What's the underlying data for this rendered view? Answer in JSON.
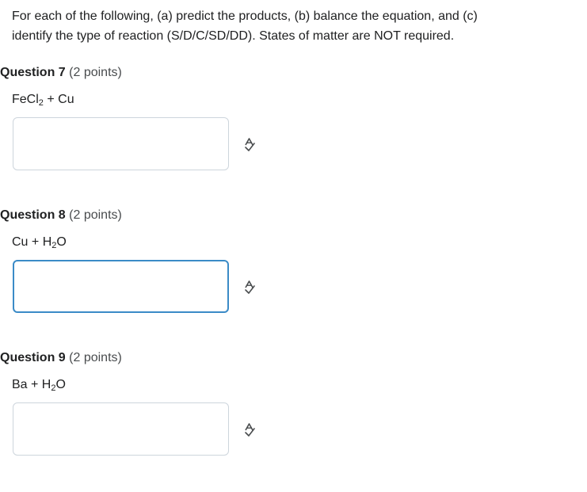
{
  "instructions": {
    "line1": "For each of the following, (a) predict the products, (b) balance the equation, and (c)",
    "line2": "identify the type of reaction (S/D/C/SD/DD). States of matter are NOT required."
  },
  "questions": [
    {
      "label": "Question 7",
      "points": "(2 points)",
      "equation": {
        "pre": "FeCl",
        "sub": "2",
        "post": " + Cu"
      },
      "answer_value": "",
      "icon": "spell-check-icon"
    },
    {
      "label": "Question 8",
      "points": "(2 points)",
      "equation": {
        "pre": "Cu + H",
        "sub": "2",
        "post": "O"
      },
      "answer_value": "",
      "icon": "spell-check-icon"
    },
    {
      "label": "Question 9",
      "points": "(2 points)",
      "equation": {
        "pre": "Ba + H",
        "sub": "2",
        "post": "O"
      },
      "answer_value": "",
      "icon": "spell-check-icon"
    }
  ],
  "colors": {
    "text": "#202122",
    "muted": "#494c4e",
    "border": "#cdd5dc",
    "focus_border": "#3b8bc7"
  }
}
